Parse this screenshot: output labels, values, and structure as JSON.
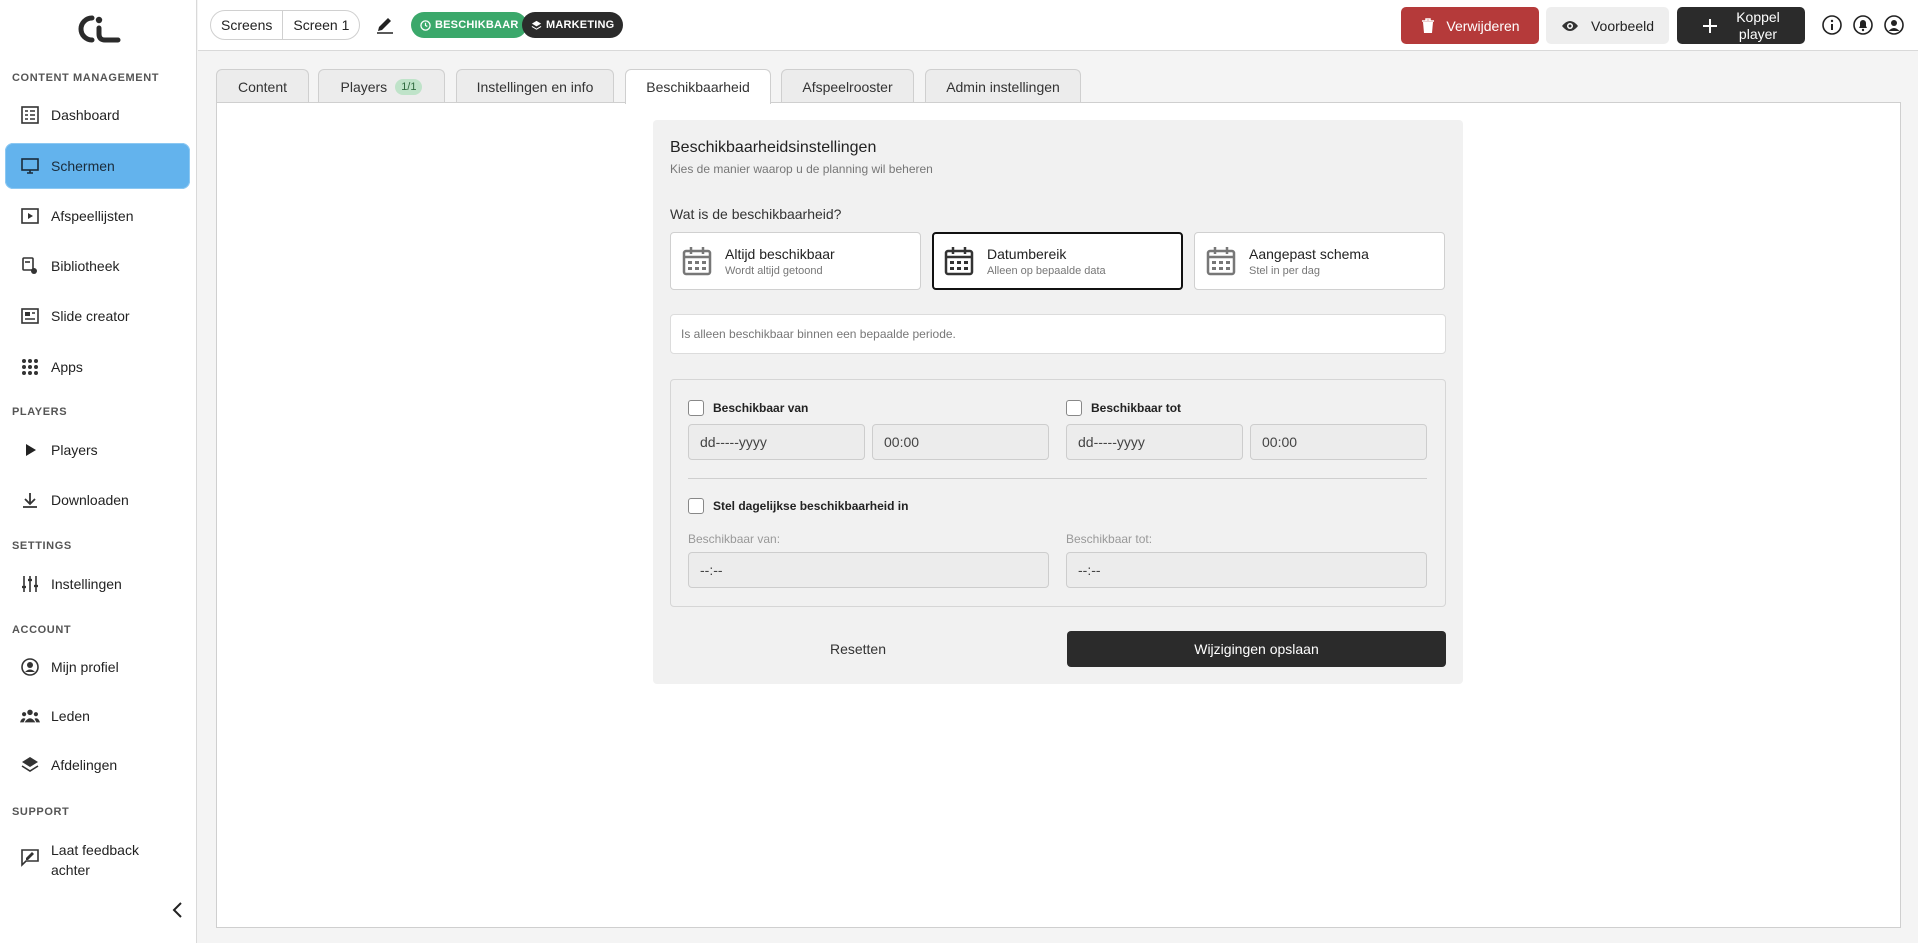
{
  "sidebar": {
    "sections": [
      "CONTENT MANAGEMENT",
      "PLAYERS",
      "SETTINGS",
      "ACCOUNT",
      "SUPPORT"
    ],
    "items": [
      {
        "label": "Dashboard",
        "icon": "dashboard-icon"
      },
      {
        "label": "Schermen",
        "icon": "monitor-icon",
        "active": true
      },
      {
        "label": "Afspeellijsten",
        "icon": "playlist-icon"
      },
      {
        "label": "Bibliotheek",
        "icon": "library-icon"
      },
      {
        "label": "Slide creator",
        "icon": "slide-creator-icon"
      },
      {
        "label": "Apps",
        "icon": "apps-grid-icon"
      },
      {
        "label": "Players",
        "icon": "play-icon"
      },
      {
        "label": "Downloaden",
        "icon": "download-icon"
      },
      {
        "label": "Instellingen",
        "icon": "sliders-icon"
      },
      {
        "label": "Mijn profiel",
        "icon": "user-circle-icon"
      },
      {
        "label": "Leden",
        "icon": "people-icon"
      },
      {
        "label": "Afdelingen",
        "icon": "layers-icon"
      },
      {
        "label": "Laat feedback achter",
        "icon": "feedback-icon"
      }
    ]
  },
  "topbar": {
    "breadcrumb": [
      "Screens",
      "Screen 1"
    ],
    "badges": [
      "BESCHIKBAAR",
      "MARKETING"
    ],
    "delete_label": "Verwijderen",
    "preview_label": "Voorbeeld",
    "koppel_label_1": "Koppel",
    "koppel_label_2": "player"
  },
  "tabs": [
    {
      "label": "Content"
    },
    {
      "label": "Players",
      "pill": "1/1"
    },
    {
      "label": "Instellingen en info"
    },
    {
      "label": "Beschikbaarheid",
      "active": true
    },
    {
      "label": "Afspeelrooster"
    },
    {
      "label": "Admin instellingen"
    }
  ],
  "availability": {
    "title": "Beschikbaarheidsinstellingen",
    "subtitle": "Kies de manier waarop u de planning wil beheren",
    "question": "Wat is de beschikbaarheid?",
    "options": [
      {
        "title": "Altijd beschikbaar",
        "sub": "Wordt altijd getoond"
      },
      {
        "title": "Datumbereik",
        "sub": "Alleen op bepaalde data",
        "selected": true
      },
      {
        "title": "Aangepast schema",
        "sub": "Stel in per dag"
      }
    ],
    "info": "Is alleen beschikbaar binnen een bepaalde periode.",
    "from_label": "Beschikbaar van",
    "to_label": "Beschikbaar tot",
    "date_placeholder": "dd-----yyyy",
    "time_placeholder": "00:00",
    "daily_label": "Stel dagelijkse beschikbaarheid in",
    "daily_from_label": "Beschikbaar van:",
    "daily_to_label": "Beschikbaar tot:",
    "daily_time_placeholder": "--:--",
    "reset_label": "Resetten",
    "save_label": "Wijzigingen opslaan"
  },
  "colors": {
    "active_nav": "#63b3ed",
    "badge_green": "#3ba86b",
    "delete_red": "#b53a3a",
    "dark": "#2b2b2b"
  }
}
